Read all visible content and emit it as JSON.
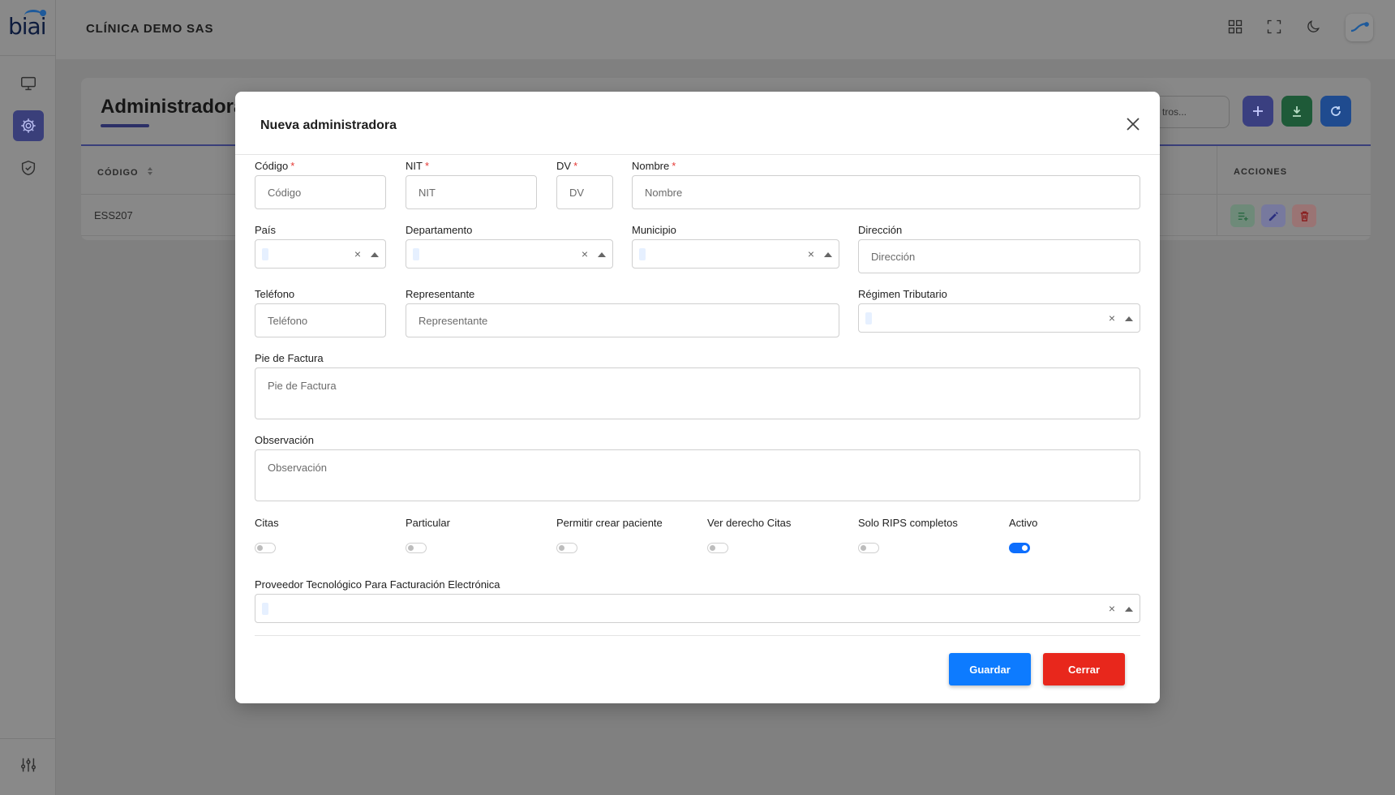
{
  "app": {
    "logo_text": "biai",
    "clinic_name": "CLÍNICA DEMO SAS"
  },
  "sidebar": {
    "items": [
      {
        "icon": "monitor-icon"
      },
      {
        "icon": "gear-icon",
        "active": true
      },
      {
        "icon": "shield-icon"
      }
    ],
    "bottom_icon": "sliders-icon"
  },
  "topbar": {
    "icons": [
      "grid-icon",
      "fullscreen-icon",
      "moon-icon"
    ]
  },
  "page": {
    "title": "Administradora",
    "search_placeholder_visible": "tros...",
    "table": {
      "headers": {
        "codigo": "CÓDIGO",
        "acciones": "ACCIONES"
      },
      "rows": [
        {
          "codigo": "ESS207"
        }
      ]
    }
  },
  "modal": {
    "title": "Nueva administradora",
    "fields": {
      "codigo": {
        "label": "Código",
        "placeholder": "Código",
        "required": "*"
      },
      "nit": {
        "label": "NIT",
        "placeholder": "NIT",
        "required": "*"
      },
      "dv": {
        "label": "DV",
        "placeholder": "DV",
        "required": "*"
      },
      "nombre": {
        "label": "Nombre",
        "placeholder": "Nombre",
        "required": "*"
      },
      "pais": {
        "label": "País"
      },
      "departamento": {
        "label": "Departamento"
      },
      "municipio": {
        "label": "Municipio"
      },
      "direccion": {
        "label": "Dirección",
        "placeholder": "Dirección"
      },
      "telefono": {
        "label": "Teléfono",
        "placeholder": "Teléfono"
      },
      "representante": {
        "label": "Representante",
        "placeholder": "Representante"
      },
      "regimen": {
        "label": "Régimen Tributario"
      },
      "pie_factura": {
        "label": "Pie de Factura",
        "placeholder": "Pie de Factura"
      },
      "observacion": {
        "label": "Observación",
        "placeholder": "Observación"
      },
      "proveedor": {
        "label": "Proveedor Tecnológico Para Facturación Electrónica"
      }
    },
    "toggles": [
      {
        "label": "Citas",
        "on": false
      },
      {
        "label": "Particular",
        "on": false
      },
      {
        "label": "Permitir crear paciente",
        "on": false
      },
      {
        "label": "Ver derecho Citas",
        "on": false
      },
      {
        "label": "Solo RIPS completos",
        "on": false
      },
      {
        "label": "Activo",
        "on": true
      }
    ],
    "buttons": {
      "save": "Guardar",
      "close": "Cerrar"
    },
    "select_clear_glyph": "×"
  },
  "colors": {
    "primary": "#0d7bff",
    "danger": "#e8271c",
    "toggle_on": "#0d6efd",
    "accent_dark": "#2b2f66"
  }
}
